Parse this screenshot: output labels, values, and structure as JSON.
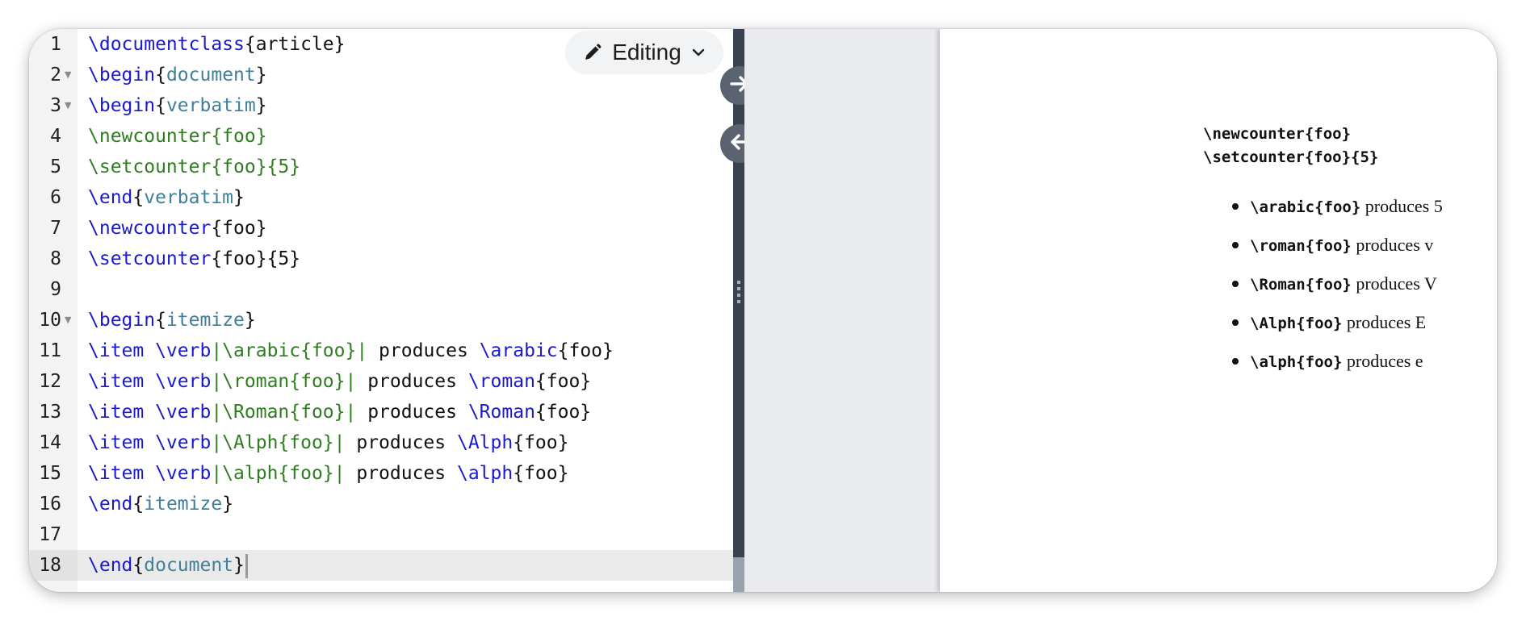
{
  "editor": {
    "mode_label": "Editing",
    "lines": [
      {
        "num": "1",
        "fold": false,
        "tokens": [
          {
            "t": "\\documentclass",
            "c": "cmd"
          },
          {
            "t": "{article}",
            "c": "txt"
          }
        ]
      },
      {
        "num": "2",
        "fold": true,
        "tokens": [
          {
            "t": "\\begin",
            "c": "cmd"
          },
          {
            "t": "{",
            "c": "txt"
          },
          {
            "t": "document",
            "c": "env"
          },
          {
            "t": "}",
            "c": "txt"
          }
        ]
      },
      {
        "num": "3",
        "fold": true,
        "tokens": [
          {
            "t": "\\begin",
            "c": "cmd"
          },
          {
            "t": "{",
            "c": "txt"
          },
          {
            "t": "verbatim",
            "c": "env"
          },
          {
            "t": "}",
            "c": "txt"
          }
        ]
      },
      {
        "num": "4",
        "fold": false,
        "tokens": [
          {
            "t": "\\newcounter{foo}",
            "c": "grn"
          }
        ]
      },
      {
        "num": "5",
        "fold": false,
        "tokens": [
          {
            "t": "\\setcounter{foo}{5}",
            "c": "grn"
          }
        ]
      },
      {
        "num": "6",
        "fold": false,
        "tokens": [
          {
            "t": "\\end",
            "c": "cmd"
          },
          {
            "t": "{",
            "c": "txt"
          },
          {
            "t": "verbatim",
            "c": "env"
          },
          {
            "t": "}",
            "c": "txt"
          }
        ]
      },
      {
        "num": "7",
        "fold": false,
        "tokens": [
          {
            "t": "\\newcounter",
            "c": "cmd"
          },
          {
            "t": "{foo}",
            "c": "txt"
          }
        ]
      },
      {
        "num": "8",
        "fold": false,
        "tokens": [
          {
            "t": "\\setcounter",
            "c": "cmd"
          },
          {
            "t": "{foo}{5}",
            "c": "txt"
          }
        ]
      },
      {
        "num": "9",
        "fold": false,
        "tokens": []
      },
      {
        "num": "10",
        "fold": true,
        "tokens": [
          {
            "t": "\\begin",
            "c": "cmd"
          },
          {
            "t": "{",
            "c": "txt"
          },
          {
            "t": "itemize",
            "c": "env"
          },
          {
            "t": "}",
            "c": "txt"
          }
        ]
      },
      {
        "num": "11",
        "fold": false,
        "tokens": [
          {
            "t": "\\item \\verb",
            "c": "cmd"
          },
          {
            "t": "|\\arabic{foo}|",
            "c": "grn"
          },
          {
            "t": " produces ",
            "c": "txt"
          },
          {
            "t": "\\arabic",
            "c": "cmd"
          },
          {
            "t": "{foo}",
            "c": "txt"
          }
        ]
      },
      {
        "num": "12",
        "fold": false,
        "tokens": [
          {
            "t": "\\item \\verb",
            "c": "cmd"
          },
          {
            "t": "|\\roman{foo}|",
            "c": "grn"
          },
          {
            "t": " produces ",
            "c": "txt"
          },
          {
            "t": "\\roman",
            "c": "cmd"
          },
          {
            "t": "{foo}",
            "c": "txt"
          }
        ]
      },
      {
        "num": "13",
        "fold": false,
        "tokens": [
          {
            "t": "\\item \\verb",
            "c": "cmd"
          },
          {
            "t": "|\\Roman{foo}|",
            "c": "grn"
          },
          {
            "t": " produces ",
            "c": "txt"
          },
          {
            "t": "\\Roman",
            "c": "cmd"
          },
          {
            "t": "{foo}",
            "c": "txt"
          }
        ]
      },
      {
        "num": "14",
        "fold": false,
        "tokens": [
          {
            "t": "\\item \\verb",
            "c": "cmd"
          },
          {
            "t": "|\\Alph{foo}|",
            "c": "grn"
          },
          {
            "t": " produces ",
            "c": "txt"
          },
          {
            "t": "\\Alph",
            "c": "cmd"
          },
          {
            "t": "{foo}",
            "c": "txt"
          }
        ]
      },
      {
        "num": "15",
        "fold": false,
        "tokens": [
          {
            "t": "\\item \\verb",
            "c": "cmd"
          },
          {
            "t": "|\\alph{foo}|",
            "c": "grn"
          },
          {
            "t": " produces ",
            "c": "txt"
          },
          {
            "t": "\\alph",
            "c": "cmd"
          },
          {
            "t": "{foo}",
            "c": "txt"
          }
        ]
      },
      {
        "num": "16",
        "fold": false,
        "tokens": [
          {
            "t": "\\end",
            "c": "cmd"
          },
          {
            "t": "{",
            "c": "txt"
          },
          {
            "t": "itemize",
            "c": "env"
          },
          {
            "t": "}",
            "c": "txt"
          }
        ]
      },
      {
        "num": "17",
        "fold": false,
        "tokens": []
      },
      {
        "num": "18",
        "fold": false,
        "active": true,
        "cursor": true,
        "tokens": [
          {
            "t": "\\end",
            "c": "cmd"
          },
          {
            "t": "{",
            "c": "txt"
          },
          {
            "t": "document",
            "c": "env"
          },
          {
            "t": "}",
            "c": "txt"
          }
        ]
      }
    ]
  },
  "controls": {
    "sync_to_pdf_icon": "arrow-right-icon",
    "sync_to_code_icon": "arrow-left-icon"
  },
  "preview": {
    "verbatim": [
      "\\newcounter{foo}",
      "\\setcounter{foo}{5}"
    ],
    "items": [
      {
        "code": "\\arabic{foo}",
        "text": " produces 5"
      },
      {
        "code": "\\roman{foo}",
        "text": " produces v"
      },
      {
        "code": "\\Roman{foo}",
        "text": " produces V"
      },
      {
        "code": "\\Alph{foo}",
        "text": " produces E"
      },
      {
        "code": "\\alph{foo}",
        "text": " produces e"
      }
    ]
  },
  "colors": {
    "command": "#1a1acc",
    "environment": "#3f7f9a",
    "verbatim": "#2e7d1f",
    "divider": "#3a4150"
  }
}
